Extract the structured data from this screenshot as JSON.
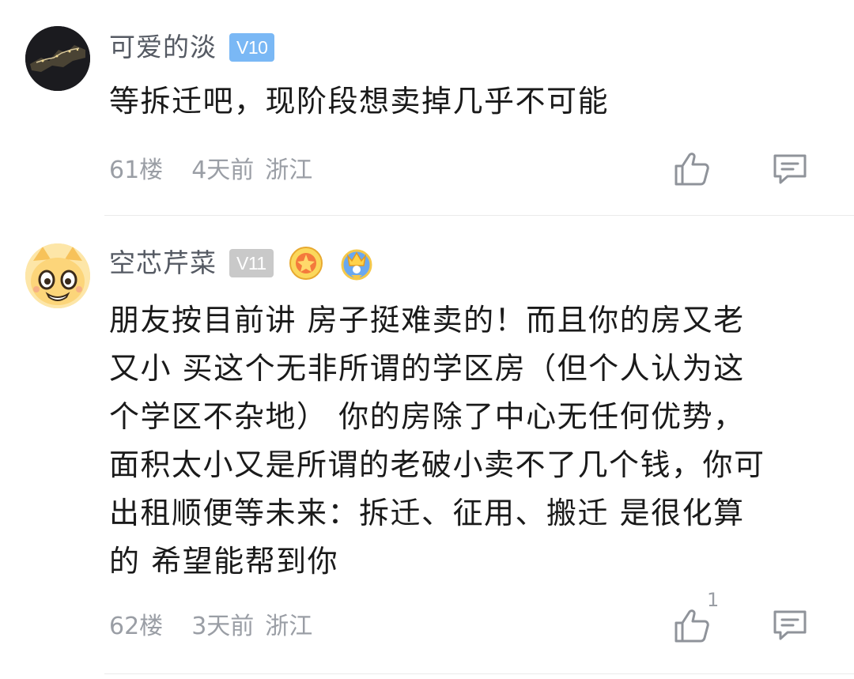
{
  "comments": [
    {
      "username": "可爱的淡",
      "level": "V10",
      "level_color": "#7ab8f5",
      "text": "等拆迁吧，现阶段想卖掉几乎不可能",
      "floor": "61楼",
      "time": "4天前",
      "region": "浙江",
      "like_count": "",
      "icons": {
        "like": "thumbs-up-icon",
        "reply": "comment-icon"
      }
    },
    {
      "username": "空芯芹菜",
      "level": "V11",
      "level_color": "#c9c9c9",
      "text_lines": [
        "朋友按目前讲 房子挺难卖的！而且你的房又老",
        "又小 买这个无非所谓的学区房（但个人认为这",
        "个学区不杂地） 你的房除了中心无任何优势，",
        "面积太小又是所谓的老破小卖不了几个钱，你可",
        "出租顺便等未来：拆迁、征用、搬迁 是很化算",
        "的 希望能帮到你"
      ],
      "floor": "62楼",
      "time": "3天前",
      "region": "浙江",
      "like_count": "1",
      "icons": {
        "like": "thumbs-up-icon",
        "reply": "comment-icon",
        "medals": [
          "orange-medal-icon",
          "crown-medal-icon"
        ]
      }
    }
  ]
}
